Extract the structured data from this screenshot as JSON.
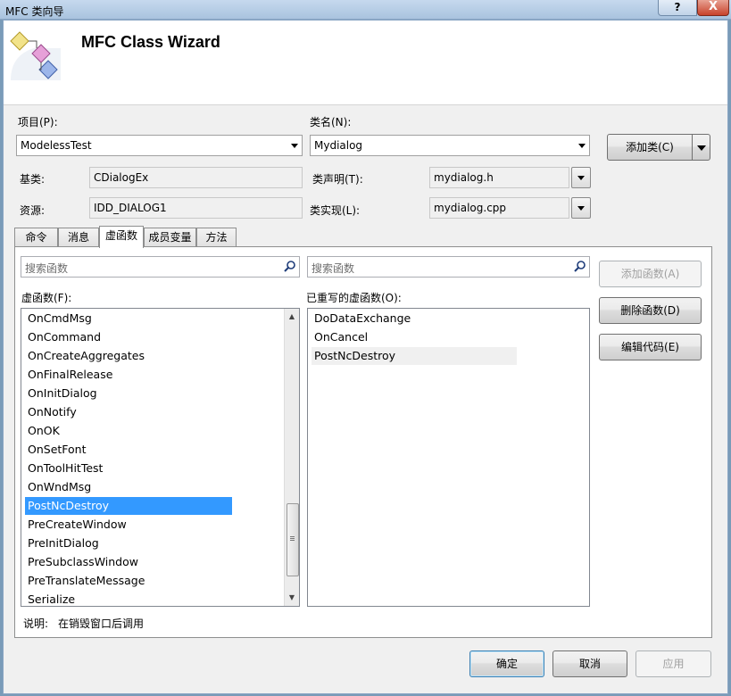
{
  "window": {
    "title": "MFC 类向导",
    "help_label": "?",
    "close_label": "X"
  },
  "header": {
    "title": "MFC Class Wizard"
  },
  "project": {
    "label": "项目(P):",
    "value": "ModelessTest"
  },
  "classname": {
    "label": "类名(N):",
    "value": "Mydialog"
  },
  "add_class_button": "添加类(C)",
  "base_class": {
    "label": "基类:",
    "value": "CDialogEx"
  },
  "resource": {
    "label": "资源:",
    "value": "IDD_DIALOG1"
  },
  "class_decl": {
    "label": "类声明(T):",
    "value": "mydialog.h"
  },
  "class_impl": {
    "label": "类实现(L):",
    "value": "mydialog.cpp"
  },
  "tabs": [
    {
      "label": "命令"
    },
    {
      "label": "消息"
    },
    {
      "label": "虚函数",
      "active": true
    },
    {
      "label": "成员变量"
    },
    {
      "label": "方法"
    }
  ],
  "search_left": {
    "placeholder": "搜索函数"
  },
  "search_right": {
    "placeholder": "搜索函数"
  },
  "virtual_functions": {
    "label": "虚函数(F):",
    "items": [
      "OnCmdMsg",
      "OnCommand",
      "OnCreateAggregates",
      "OnFinalRelease",
      "OnInitDialog",
      "OnNotify",
      "OnOK",
      "OnSetFont",
      "OnToolHitTest",
      "OnWndMsg",
      "PostNcDestroy",
      "PreCreateWindow",
      "PreInitDialog",
      "PreSubclassWindow",
      "PreTranslateMessage",
      "Serialize"
    ],
    "selected": "PostNcDestroy"
  },
  "overridden_functions": {
    "label": "已重写的虚函数(O):",
    "items": [
      "DoDataExchange",
      "OnCancel",
      "PostNcDestroy"
    ],
    "highlighted": "PostNcDestroy"
  },
  "actions": {
    "add_function": "添加函数(A)",
    "delete_function": "删除函数(D)",
    "edit_code": "编辑代码(E)"
  },
  "description": {
    "label": "说明:",
    "text": "在销毁窗口后调用"
  },
  "footer": {
    "ok": "确定",
    "cancel": "取消",
    "apply": "应用"
  }
}
